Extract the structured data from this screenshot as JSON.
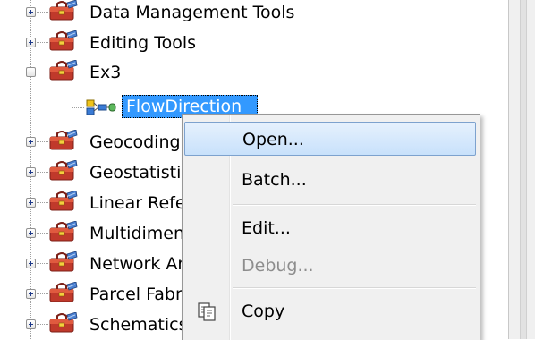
{
  "tree": {
    "items": [
      {
        "label": "Data Management Tools",
        "expanded": false
      },
      {
        "label": "Editing Tools",
        "expanded": false
      },
      {
        "label": "Ex3",
        "expanded": true
      },
      {
        "label": "Geocoding Tools",
        "expanded": false
      },
      {
        "label": "Geostatistical Analyst Tools",
        "expanded": false
      },
      {
        "label": "Linear Referencing Tools",
        "expanded": false
      },
      {
        "label": "Multidimension Tools",
        "expanded": false
      },
      {
        "label": "Network Analyst Tools",
        "expanded": false
      },
      {
        "label": "Parcel Fabric Tools",
        "expanded": false
      },
      {
        "label": "Schematics Tools",
        "expanded": false
      }
    ],
    "child": {
      "label": "FlowDirection",
      "icon": "model-tool-icon"
    }
  },
  "context_menu": {
    "items": [
      {
        "label": "Open...",
        "state": "hover"
      },
      {
        "label": "Batch...",
        "state": "normal"
      },
      {
        "label": "Edit...",
        "state": "normal"
      },
      {
        "label": "Debug...",
        "state": "disabled"
      },
      {
        "label": "Copy",
        "state": "normal",
        "icon": "copy-icon"
      }
    ]
  },
  "colors": {
    "selection": "#3399ff",
    "menu_bg": "#f0f0f0",
    "hover_border": "#7da2ce"
  }
}
